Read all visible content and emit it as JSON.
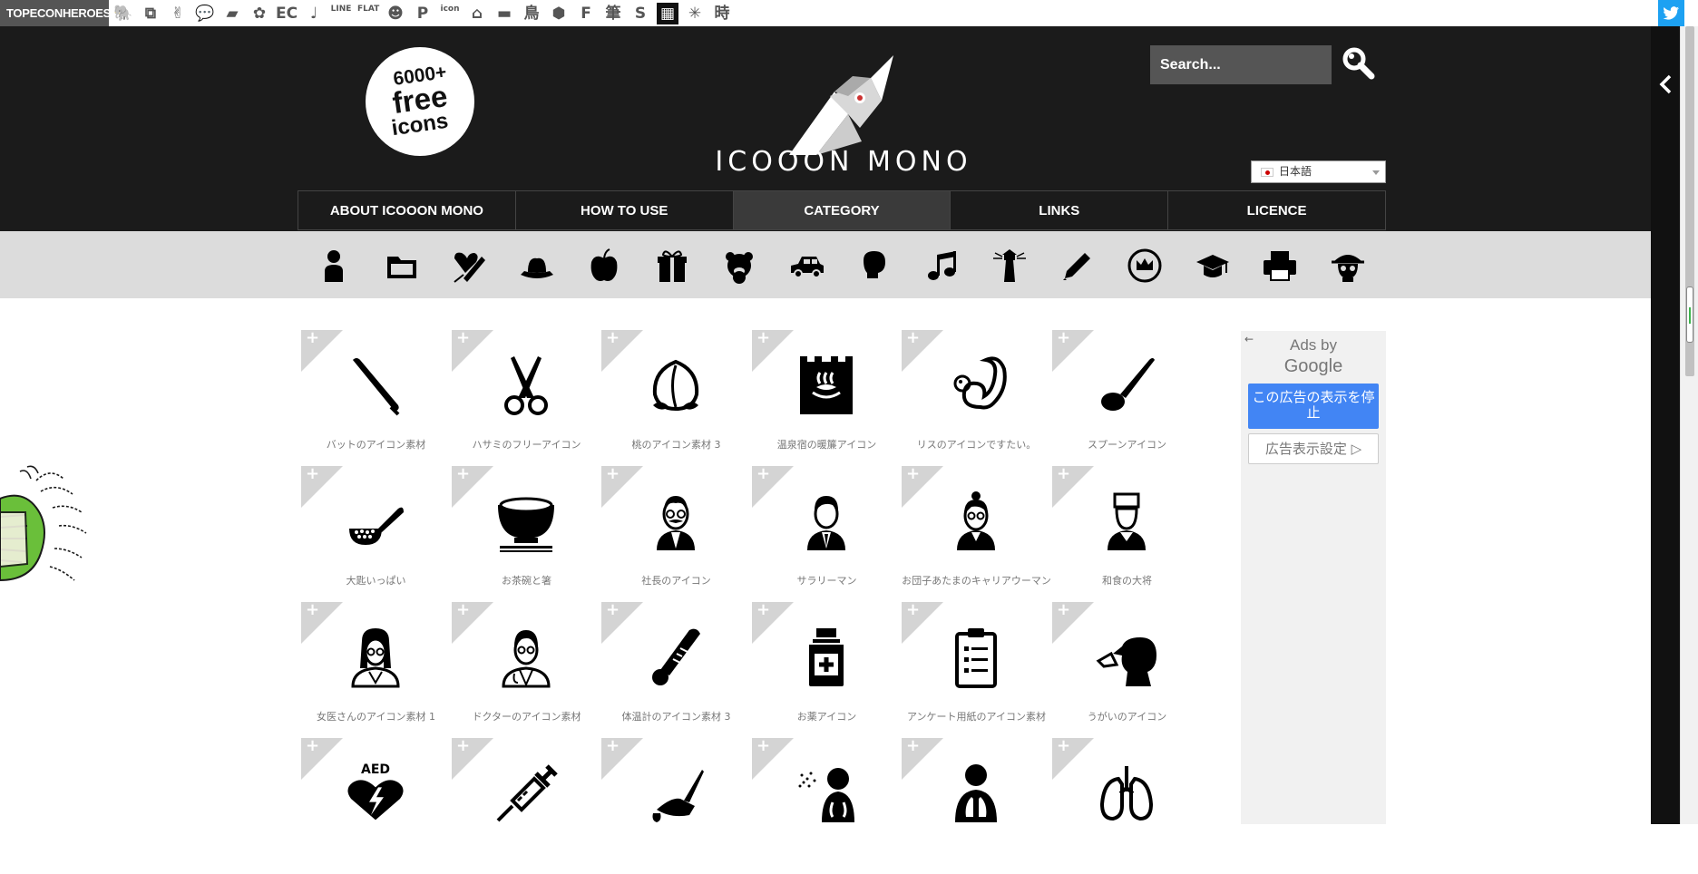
{
  "topbar": {
    "brand": "TOPECONHEROES",
    "sites": [
      {
        "icon": "elephant-icon",
        "glyph": "🐘"
      },
      {
        "icon": "copy-icon",
        "glyph": "⧉"
      },
      {
        "icon": "stick-figure-icon",
        "glyph": "✌"
      },
      {
        "icon": "speech-bubble-icon",
        "glyph": "💬"
      },
      {
        "icon": "postit-icon",
        "glyph": "▰"
      },
      {
        "icon": "flower-icon",
        "glyph": "✿"
      },
      {
        "icon": "ec-icon",
        "glyph": "EC"
      },
      {
        "icon": "music-note-icon",
        "glyph": "♩"
      },
      {
        "icon": "line-icon",
        "glyph": "LINE"
      },
      {
        "icon": "flat-icon",
        "glyph": "FLAT"
      },
      {
        "icon": "smiley-icon",
        "glyph": "☻"
      },
      {
        "icon": "p-icon",
        "glyph": "P"
      },
      {
        "icon": "icon-icon",
        "glyph": "icon"
      },
      {
        "icon": "house-icon",
        "glyph": "⌂"
      },
      {
        "icon": "sofa-icon",
        "glyph": "▬"
      },
      {
        "icon": "bird-kanji-icon",
        "glyph": "鳥"
      },
      {
        "icon": "pattern-icon",
        "glyph": "⬢"
      },
      {
        "icon": "f-icon",
        "glyph": "F"
      },
      {
        "icon": "brush-kanji-icon",
        "glyph": "筆"
      },
      {
        "icon": "s-icon",
        "glyph": "S"
      },
      {
        "icon": "grid-icon",
        "glyph": "▦"
      },
      {
        "icon": "burst-icon",
        "glyph": "✳"
      },
      {
        "icon": "time-kanji-icon",
        "glyph": "時"
      }
    ]
  },
  "header": {
    "badge": {
      "line1": "6000+",
      "line2": "free",
      "line3": "icons"
    },
    "title": "ICOOON MONO",
    "search_placeholder": "Search...",
    "language": "日本語",
    "nav": [
      {
        "label": "ABOUT ICOOON MONO",
        "active": false
      },
      {
        "label": "HOW TO USE",
        "active": false
      },
      {
        "label": "CATEGORY",
        "active": true
      },
      {
        "label": "LINKS",
        "active": false
      },
      {
        "label": "LICENCE",
        "active": false
      }
    ]
  },
  "categories": [
    "person-icon",
    "folder-icon",
    "heart-syringe-icon",
    "hat-icon",
    "apple-icon",
    "gift-icon",
    "bear-icon",
    "car-icon",
    "boxing-glove-icon",
    "music-note-icon",
    "lighthouse-icon",
    "pencil-icon",
    "crown-badge-icon",
    "graduation-cap-icon",
    "printer-icon",
    "pirate-skull-icon"
  ],
  "icons": [
    {
      "label": "バットのアイコン素材",
      "icon": "baseball-bat-icon"
    },
    {
      "label": "ハサミのフリーアイコン",
      "icon": "scissors-icon"
    },
    {
      "label": "桃のアイコン素材 3",
      "icon": "peach-icon"
    },
    {
      "label": "温泉宿の暖簾アイコン",
      "icon": "hot-spring-curtain-icon"
    },
    {
      "label": "リスのアイコンですたい。",
      "icon": "squirrel-icon"
    },
    {
      "label": "スプーンアイコン",
      "icon": "spoon-icon"
    },
    {
      "label": "大匙いっぱい",
      "icon": "ladle-icon"
    },
    {
      "label": "お茶碗と箸",
      "icon": "rice-bowl-icon"
    },
    {
      "label": "社長のアイコン",
      "icon": "president-icon"
    },
    {
      "label": "サラリーマン",
      "icon": "salaryman-icon"
    },
    {
      "label": "お団子あたまのキャリアウーマン",
      "icon": "career-woman-icon"
    },
    {
      "label": "和食の大将",
      "icon": "chef-icon"
    },
    {
      "label": "女医さんのアイコン素材 1",
      "icon": "female-doctor-icon"
    },
    {
      "label": "ドクターのアイコン素材",
      "icon": "doctor-icon"
    },
    {
      "label": "体温計のアイコン素材 3",
      "icon": "thermometer-icon"
    },
    {
      "label": "お薬アイコン",
      "icon": "medicine-bottle-icon"
    },
    {
      "label": "アンケート用紙のアイコン素材",
      "icon": "clipboard-icon"
    },
    {
      "label": "うがいのアイコン",
      "icon": "gargle-icon"
    },
    {
      "label": "",
      "icon": "aed-icon",
      "text": "AED"
    },
    {
      "label": "",
      "icon": "syringe-icon"
    },
    {
      "label": "",
      "icon": "scalpel-icon"
    },
    {
      "label": "",
      "icon": "spray-lungs-icon"
    },
    {
      "label": "",
      "icon": "lungs-body-icon"
    },
    {
      "label": "",
      "icon": "lungs-icon"
    }
  ],
  "ad": {
    "back": "←",
    "by": "Ads by",
    "google": "Google",
    "stop": "この広告の表示を停止",
    "settings": "広告表示設定 ▷"
  }
}
